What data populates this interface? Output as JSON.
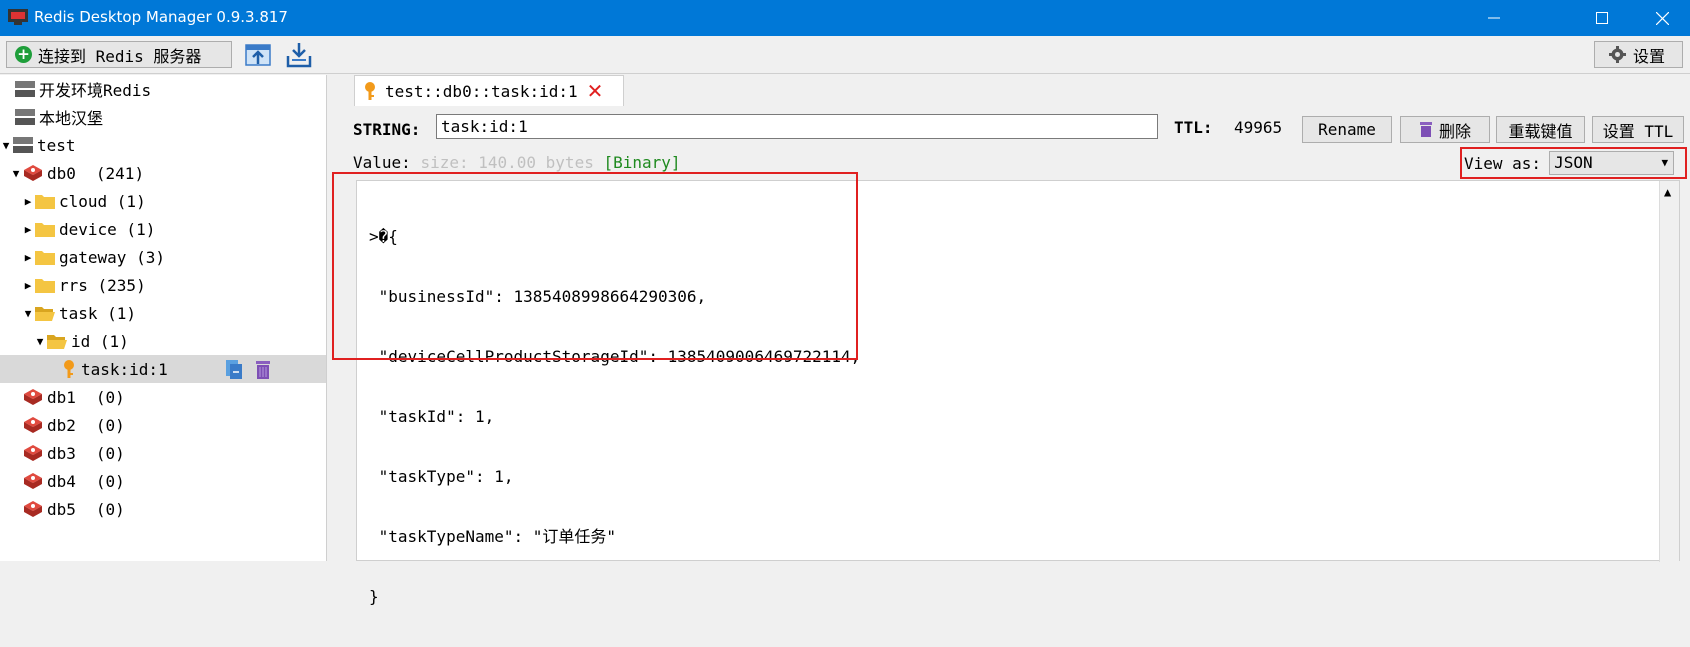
{
  "window": {
    "title": "Redis Desktop Manager 0.9.3.817"
  },
  "toolbar": {
    "connect_label": "连接到 Redis 服务器",
    "settings_label": "设置"
  },
  "tree": {
    "connections": [
      "开发环境Redis",
      "本地汉堡"
    ],
    "server": "test",
    "db0": {
      "label": "db0",
      "count": "(241)"
    },
    "folders": [
      {
        "label": "cloud (1)"
      },
      {
        "label": "device (1)"
      },
      {
        "label": "gateway (3)"
      },
      {
        "label": "rrs (235)"
      },
      {
        "label": "task (1)"
      }
    ],
    "subfolder": "id (1)",
    "key": "task:id:1",
    "dbs": [
      {
        "label": "db1",
        "count": "(0)"
      },
      {
        "label": "db2",
        "count": "(0)"
      },
      {
        "label": "db3",
        "count": "(0)"
      },
      {
        "label": "db4",
        "count": "(0)"
      },
      {
        "label": "db5",
        "count": "(0)"
      }
    ]
  },
  "tab": {
    "label": "test::db0::task:id:1"
  },
  "key_panel": {
    "type_label": "STRING:",
    "key_name": "task:id:1",
    "ttl_label": "TTL:",
    "ttl_value": "49965",
    "rename_label": "Rename",
    "delete_label": "删除",
    "reload_label": "重载键值",
    "set_ttl_label": "设置 TTL"
  },
  "value": {
    "label": "Value:",
    "size": "size: 140.00 bytes",
    "binary": "[Binary]",
    "view_as_label": "View as:",
    "view_as_value": "JSON",
    "lines": [
      ">�{",
      " \"businessId\": 1385408998664290306,",
      " \"deviceCellProductStorageId\": 1385409006469722114,",
      " \"taskId\": 1,",
      " \"taskType\": 1,",
      " \"taskTypeName\": \"订单任务\"",
      "}"
    ]
  },
  "colors": {
    "titlebar": "#0078d7",
    "highlight": "#e02020",
    "selected_row": "#d9d9d9"
  }
}
